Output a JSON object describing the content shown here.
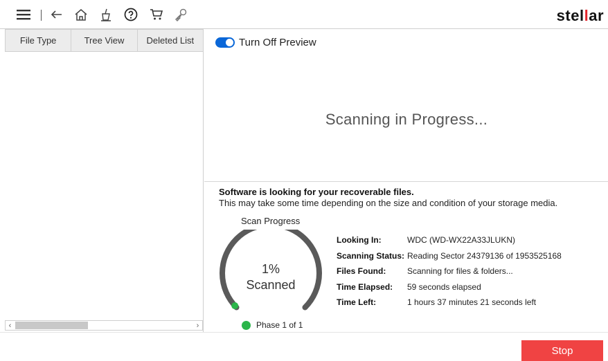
{
  "toolbar": {
    "icons": [
      "menu-icon",
      "back-arrow-icon",
      "home-icon",
      "clean-icon",
      "help-icon",
      "cart-icon",
      "key-icon"
    ],
    "logo_prefix": "stel",
    "logo_accent": "l",
    "logo_suffix": "ar"
  },
  "left_panel": {
    "tabs": [
      {
        "label": "File Type"
      },
      {
        "label": "Tree View"
      },
      {
        "label": "Deleted List"
      }
    ]
  },
  "preview": {
    "toggle_label": "Turn Off Preview",
    "toggle_on": true
  },
  "scan": {
    "title": "Scanning in Progress...",
    "heading": "Software is looking for your recoverable files.",
    "subheading": "This may take some time depending on the size and condition of your storage media.",
    "progress_label": "Scan Progress",
    "percent_text": "1%",
    "percent_value": 0.01,
    "scanned_label": "Scanned",
    "phase": "Phase 1 of 1",
    "details": [
      {
        "key": "Looking In:",
        "value": "WDC (WD-WX22A33JLUKN)"
      },
      {
        "key": "Scanning Status:",
        "value": "Reading Sector 24379136 of 1953525168"
      },
      {
        "key": "Files Found:",
        "value": "Scanning for files & folders..."
      },
      {
        "key": "Time Elapsed:",
        "value": "59 seconds elapsed"
      },
      {
        "key": "Time Left:",
        "value": "1 hours 37 minutes 21 seconds left"
      }
    ]
  },
  "actions": {
    "stop_label": "Stop"
  },
  "colors": {
    "accent_blue": "#0a67d8",
    "stop_red": "#f04343",
    "phase_green": "#2bb54a",
    "gauge_gray": "#5a5a5a"
  }
}
